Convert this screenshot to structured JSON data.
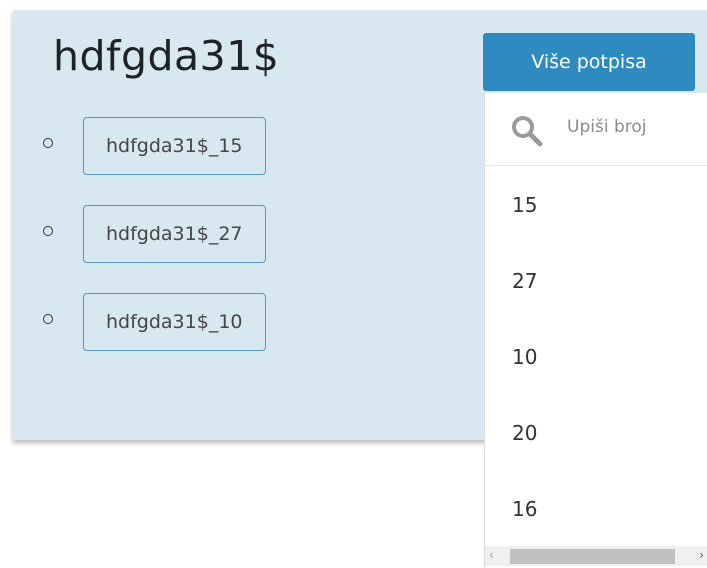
{
  "card": {
    "title": "hdfgda31$",
    "signatures": [
      {
        "label": "hdfgda31$_15"
      },
      {
        "label": "hdfgda31$_27"
      },
      {
        "label": "hdfgda31$_10"
      }
    ]
  },
  "more_button": {
    "label": "Više potpisa"
  },
  "dropdown": {
    "search_placeholder": "Upiši broj",
    "options": [
      "15",
      "27",
      "10",
      "20",
      "16"
    ]
  },
  "colors": {
    "card_bg": "#d7e8f0",
    "accent": "#2f8ac0",
    "chip_border": "#4a9bc8"
  },
  "icons": [
    "search-icon",
    "scroll-left-arrow-icon",
    "scroll-right-arrow-icon"
  ]
}
